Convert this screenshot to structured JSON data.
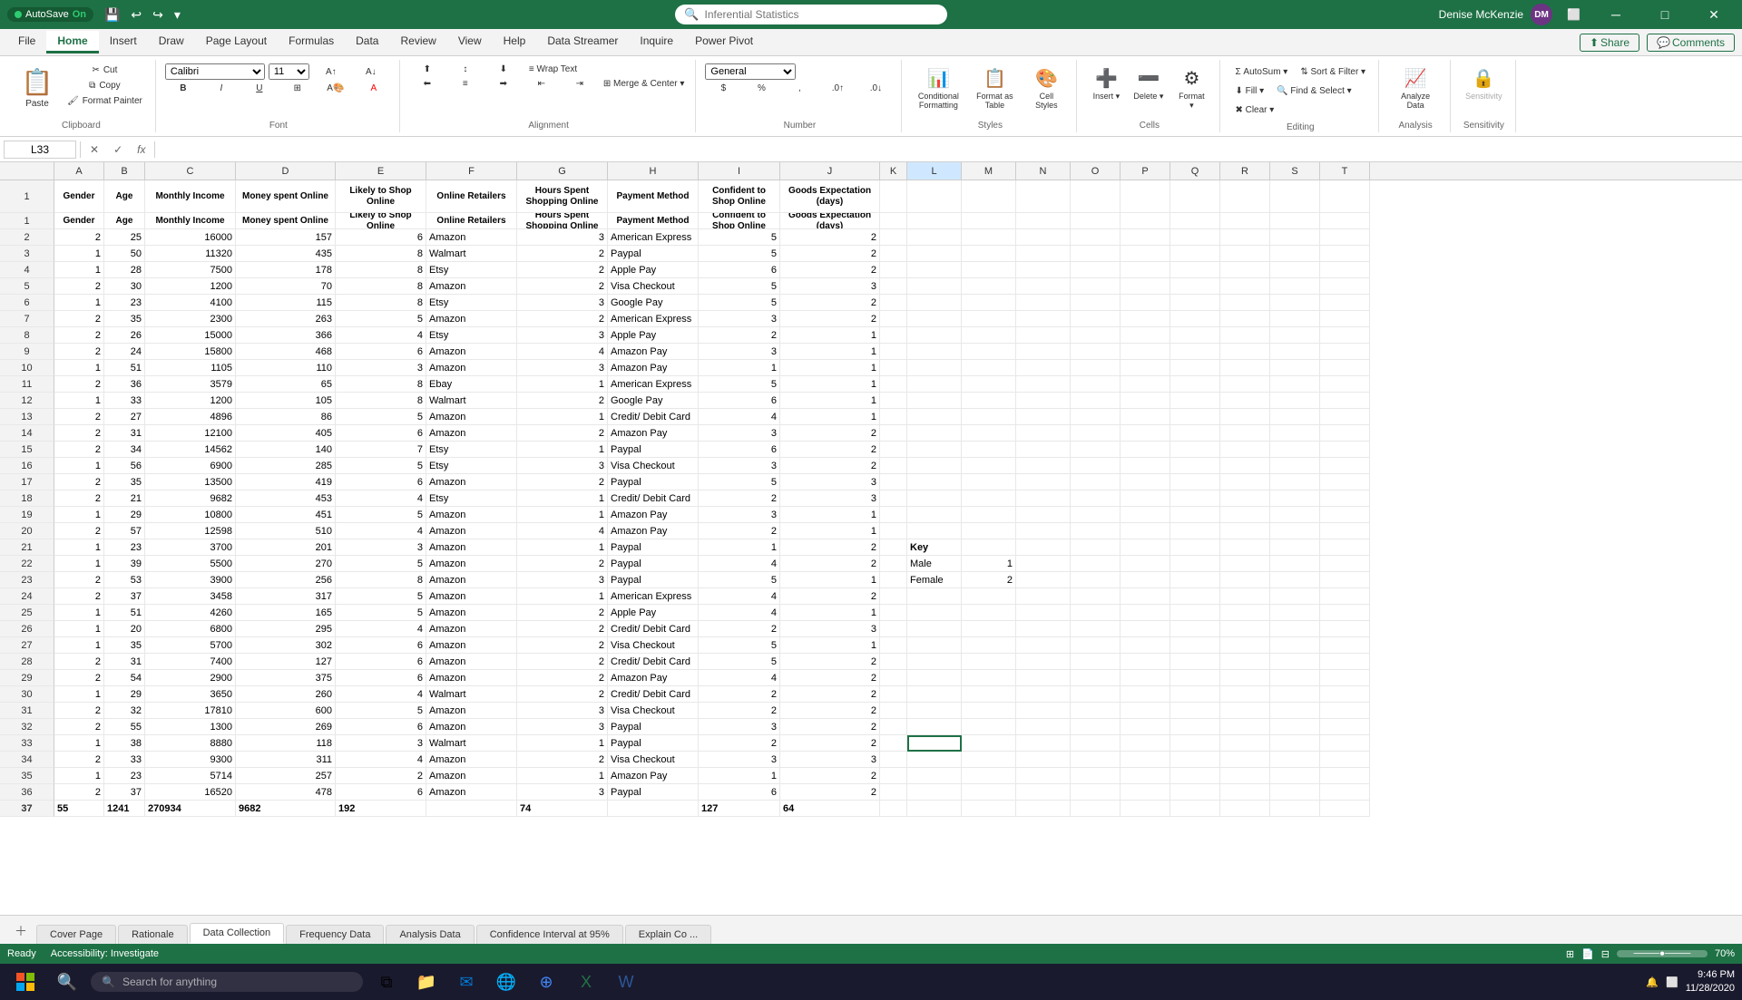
{
  "titlebar": {
    "autosave_label": "AutoSave",
    "autosave_state": "On",
    "title": "Inferential Statistics",
    "user": "Denise McKenzie",
    "user_initials": "DM"
  },
  "ribbon": {
    "tabs": [
      "File",
      "Home",
      "Insert",
      "Draw",
      "Page Layout",
      "Formulas",
      "Data",
      "Review",
      "View",
      "Help",
      "Data Streamer",
      "Inquire",
      "Power Pivot"
    ],
    "active_tab": "Home",
    "groups": {
      "clipboard": {
        "label": "Clipboard",
        "buttons": [
          "Paste",
          "Cut",
          "Copy",
          "Format Painter"
        ]
      },
      "font": {
        "label": "Font",
        "font_name": "Calibri",
        "font_size": "11"
      },
      "alignment": {
        "label": "Alignment",
        "wrap_text": "Wrap Text",
        "merge_center": "Merge & Center"
      },
      "number": {
        "label": "Number",
        "format": "General"
      },
      "styles": {
        "label": "Styles",
        "conditional_formatting": "Conditional Formatting",
        "format_as_table": "Format as Table",
        "cell_styles": "Cell Styles"
      },
      "cells": {
        "label": "Cells",
        "insert": "Insert",
        "delete": "Delete",
        "format": "Format"
      },
      "editing": {
        "label": "Editing",
        "autosum": "AutoSum",
        "fill": "Fill",
        "clear": "Clear",
        "sort_filter": "Sort & Filter",
        "find_select": "Find & Select"
      },
      "analysis": {
        "label": "Analysis",
        "analyze_data": "Analyze Data"
      },
      "sensitivity": {
        "label": "Sensitivity",
        "sensitivity": "Sensitivity"
      }
    }
  },
  "formula_bar": {
    "cell_ref": "L33",
    "formula": ""
  },
  "columns": {
    "letters": [
      "A",
      "B",
      "C",
      "D",
      "E",
      "F",
      "G",
      "H",
      "I",
      "J",
      "K",
      "L",
      "M",
      "N",
      "O",
      "P",
      "Q",
      "R",
      "S",
      "T"
    ],
    "headers": {
      "A": "Gender",
      "B": "Age",
      "C": "Monthly Income",
      "D": "Money spent Online",
      "E": "Likely to Shop Online",
      "F": "Online Retailers",
      "G": "Hours Spent Shopping Online",
      "H": "Payment Method",
      "I": "Confident to Shop Online",
      "J": "Goods Expectation (days)"
    }
  },
  "rows": [
    {
      "num": 1,
      "A": "Gender",
      "B": "Age",
      "C": "Monthly Income",
      "D": "Money spent Online",
      "E": "Likely to Shop Online",
      "F": "Online Retailers",
      "G": "Hours Spent Shopping Online",
      "H": "Payment Method",
      "I": "Confident to Shop Online",
      "J": "Goods Expectation (days)",
      "is_header": true
    },
    {
      "num": 2,
      "A": "2",
      "B": "25",
      "C": "16000",
      "D": "157",
      "E": "6",
      "F": "Amazon",
      "G": "3",
      "H": "American Express",
      "I": "5",
      "J": "2"
    },
    {
      "num": 3,
      "A": "1",
      "B": "50",
      "C": "11320",
      "D": "435",
      "E": "8",
      "F": "Walmart",
      "G": "2",
      "H": "Paypal",
      "I": "5",
      "J": "2"
    },
    {
      "num": 4,
      "A": "1",
      "B": "28",
      "C": "7500",
      "D": "178",
      "E": "8",
      "F": "Etsy",
      "G": "2",
      "H": "Apple Pay",
      "I": "6",
      "J": "2"
    },
    {
      "num": 5,
      "A": "2",
      "B": "30",
      "C": "1200",
      "D": "70",
      "E": "8",
      "F": "Amazon",
      "G": "2",
      "H": "Visa Checkout",
      "I": "5",
      "J": "3"
    },
    {
      "num": 6,
      "A": "1",
      "B": "23",
      "C": "4100",
      "D": "115",
      "E": "8",
      "F": "Etsy",
      "G": "3",
      "H": "Google Pay",
      "I": "5",
      "J": "2"
    },
    {
      "num": 7,
      "A": "2",
      "B": "35",
      "C": "2300",
      "D": "263",
      "E": "5",
      "F": "Amazon",
      "G": "2",
      "H": "American Express",
      "I": "3",
      "J": "2"
    },
    {
      "num": 8,
      "A": "2",
      "B": "26",
      "C": "15000",
      "D": "366",
      "E": "4",
      "F": "Etsy",
      "G": "3",
      "H": "Apple Pay",
      "I": "2",
      "J": "1"
    },
    {
      "num": 9,
      "A": "2",
      "B": "24",
      "C": "15800",
      "D": "468",
      "E": "6",
      "F": "Amazon",
      "G": "4",
      "H": "Amazon Pay",
      "I": "3",
      "J": "1"
    },
    {
      "num": 10,
      "A": "1",
      "B": "51",
      "C": "1105",
      "D": "110",
      "E": "3",
      "F": "Amazon",
      "G": "3",
      "H": "Amazon Pay",
      "I": "1",
      "J": "1"
    },
    {
      "num": 11,
      "A": "2",
      "B": "36",
      "C": "3579",
      "D": "65",
      "E": "8",
      "F": "Ebay",
      "G": "1",
      "H": "American Express",
      "I": "5",
      "J": "1"
    },
    {
      "num": 12,
      "A": "1",
      "B": "33",
      "C": "1200",
      "D": "105",
      "E": "8",
      "F": "Walmart",
      "G": "2",
      "H": "Google Pay",
      "I": "6",
      "J": "1"
    },
    {
      "num": 13,
      "A": "2",
      "B": "27",
      "C": "4896",
      "D": "86",
      "E": "5",
      "F": "Amazon",
      "G": "1",
      "H": "Credit/ Debit Card",
      "I": "4",
      "J": "1"
    },
    {
      "num": 14,
      "A": "2",
      "B": "31",
      "C": "12100",
      "D": "405",
      "E": "6",
      "F": "Amazon",
      "G": "2",
      "H": "Amazon Pay",
      "I": "3",
      "J": "2"
    },
    {
      "num": 15,
      "A": "2",
      "B": "34",
      "C": "14562",
      "D": "140",
      "E": "7",
      "F": "Etsy",
      "G": "1",
      "H": "Paypal",
      "I": "6",
      "J": "2"
    },
    {
      "num": 16,
      "A": "1",
      "B": "56",
      "C": "6900",
      "D": "285",
      "E": "5",
      "F": "Etsy",
      "G": "3",
      "H": "Visa Checkout",
      "I": "3",
      "J": "2"
    },
    {
      "num": 17,
      "A": "2",
      "B": "35",
      "C": "13500",
      "D": "419",
      "E": "6",
      "F": "Amazon",
      "G": "2",
      "H": "Paypal",
      "I": "5",
      "J": "3"
    },
    {
      "num": 18,
      "A": "2",
      "B": "21",
      "C": "9682",
      "D": "453",
      "E": "4",
      "F": "Etsy",
      "G": "1",
      "H": "Credit/ Debit Card",
      "I": "2",
      "J": "3"
    },
    {
      "num": 19,
      "A": "1",
      "B": "29",
      "C": "10800",
      "D": "451",
      "E": "5",
      "F": "Amazon",
      "G": "1",
      "H": "Amazon Pay",
      "I": "3",
      "J": "1"
    },
    {
      "num": 20,
      "A": "2",
      "B": "57",
      "C": "12598",
      "D": "510",
      "E": "4",
      "F": "Amazon",
      "G": "4",
      "H": "Amazon Pay",
      "I": "2",
      "J": "1"
    },
    {
      "num": 21,
      "A": "1",
      "B": "23",
      "C": "3700",
      "D": "201",
      "E": "3",
      "F": "Amazon",
      "G": "1",
      "H": "Paypal",
      "I": "1",
      "J": "2"
    },
    {
      "num": 22,
      "A": "1",
      "B": "39",
      "C": "5500",
      "D": "270",
      "E": "5",
      "F": "Amazon",
      "G": "2",
      "H": "Paypal",
      "I": "4",
      "J": "2"
    },
    {
      "num": 23,
      "A": "2",
      "B": "53",
      "C": "3900",
      "D": "256",
      "E": "8",
      "F": "Amazon",
      "G": "3",
      "H": "Paypal",
      "I": "5",
      "J": "1"
    },
    {
      "num": 24,
      "A": "2",
      "B": "37",
      "C": "3458",
      "D": "317",
      "E": "5",
      "F": "Amazon",
      "G": "1",
      "H": "American Express",
      "I": "4",
      "J": "2"
    },
    {
      "num": 25,
      "A": "1",
      "B": "51",
      "C": "4260",
      "D": "165",
      "E": "5",
      "F": "Amazon",
      "G": "2",
      "H": "Apple Pay",
      "I": "4",
      "J": "1"
    },
    {
      "num": 26,
      "A": "1",
      "B": "20",
      "C": "6800",
      "D": "295",
      "E": "4",
      "F": "Amazon",
      "G": "2",
      "H": "Credit/ Debit Card",
      "I": "2",
      "J": "3"
    },
    {
      "num": 27,
      "A": "1",
      "B": "35",
      "C": "5700",
      "D": "302",
      "E": "6",
      "F": "Amazon",
      "G": "2",
      "H": "Visa Checkout",
      "I": "5",
      "J": "1"
    },
    {
      "num": 28,
      "A": "2",
      "B": "31",
      "C": "7400",
      "D": "127",
      "E": "6",
      "F": "Amazon",
      "G": "2",
      "H": "Credit/ Debit Card",
      "I": "5",
      "J": "2"
    },
    {
      "num": 29,
      "A": "2",
      "B": "54",
      "C": "2900",
      "D": "375",
      "E": "6",
      "F": "Amazon",
      "G": "2",
      "H": "Amazon Pay",
      "I": "4",
      "J": "2"
    },
    {
      "num": 30,
      "A": "1",
      "B": "29",
      "C": "3650",
      "D": "260",
      "E": "4",
      "F": "Walmart",
      "G": "2",
      "H": "Credit/ Debit Card",
      "I": "2",
      "J": "2"
    },
    {
      "num": 31,
      "A": "2",
      "B": "32",
      "C": "17810",
      "D": "600",
      "E": "5",
      "F": "Amazon",
      "G": "3",
      "H": "Visa Checkout",
      "I": "2",
      "J": "2"
    },
    {
      "num": 32,
      "A": "2",
      "B": "55",
      "C": "1300",
      "D": "269",
      "E": "6",
      "F": "Amazon",
      "G": "3",
      "H": "Paypal",
      "I": "3",
      "J": "2"
    },
    {
      "num": 33,
      "A": "1",
      "B": "38",
      "C": "8880",
      "D": "118",
      "E": "3",
      "F": "Walmart",
      "G": "1",
      "H": "Paypal",
      "I": "2",
      "J": "2",
      "selected_L": true
    },
    {
      "num": 34,
      "A": "2",
      "B": "33",
      "C": "9300",
      "D": "311",
      "E": "4",
      "F": "Amazon",
      "G": "2",
      "H": "Visa Checkout",
      "I": "3",
      "J": "3"
    },
    {
      "num": 35,
      "A": "1",
      "B": "23",
      "C": "5714",
      "D": "257",
      "E": "2",
      "F": "Amazon",
      "G": "1",
      "H": "Amazon Pay",
      "I": "1",
      "J": "2"
    },
    {
      "num": 36,
      "A": "2",
      "B": "37",
      "C": "16520",
      "D": "478",
      "E": "6",
      "F": "Amazon",
      "G": "3",
      "H": "Paypal",
      "I": "6",
      "J": "2"
    },
    {
      "num": 37,
      "A": "55",
      "B": "1241",
      "C": "270934",
      "D": "9682",
      "E": "192",
      "F": "",
      "G": "74",
      "H": "",
      "I": "127",
      "J": "64",
      "is_total": true
    }
  ],
  "key_data": {
    "title": "Key",
    "male_label": "Male",
    "male_value": "1",
    "female_label": "Female",
    "female_value": "2"
  },
  "sheet_tabs": [
    "Cover Page",
    "Rationale",
    "Data Collection",
    "Frequency Data",
    "Analysis Data",
    "Confidence Interval at 95%",
    "Explain Co ..."
  ],
  "active_sheet": "Data Collection",
  "status_bar": {
    "ready": "Ready",
    "accessibility": "Accessibility: Investigate",
    "view_normal": "Normal",
    "view_layout": "Page Layout",
    "view_page_break": "Page Break",
    "zoom": "70%"
  },
  "taskbar": {
    "time": "9:46 PM",
    "date": "11/28/2020",
    "search_placeholder": "Search for anything"
  }
}
